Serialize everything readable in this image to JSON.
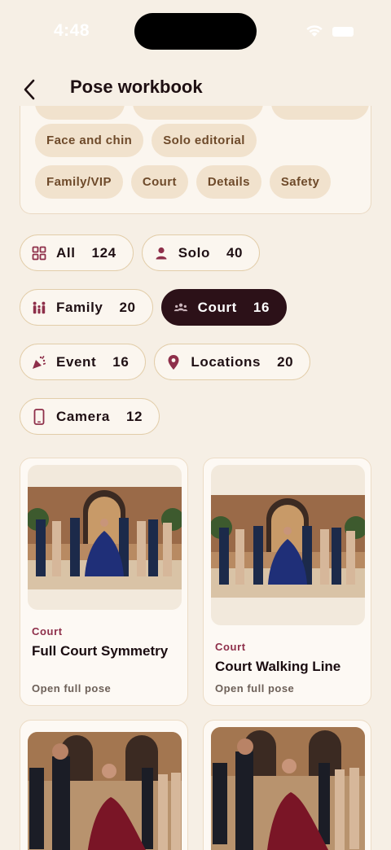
{
  "status": {
    "time": "4:48"
  },
  "header": {
    "title": "Pose workbook",
    "back_icon": "chevron-left-icon"
  },
  "tips": {
    "row1": [
      "Face and chin",
      "Solo editorial"
    ],
    "row2": [
      "Family/VIP",
      "Court",
      "Details",
      "Safety"
    ]
  },
  "filters": [
    {
      "label": "All",
      "count": "124",
      "icon": "grid-icon",
      "active": false
    },
    {
      "label": "Solo",
      "count": "40",
      "icon": "person-icon",
      "active": false
    },
    {
      "label": "Family",
      "count": "20",
      "icon": "family-icon",
      "active": false
    },
    {
      "label": "Court",
      "count": "16",
      "icon": "group-icon",
      "active": true
    },
    {
      "label": "Event",
      "count": "16",
      "icon": "party-popper-icon",
      "active": false
    },
    {
      "label": "Locations",
      "count": "20",
      "icon": "location-pin-icon",
      "active": false
    },
    {
      "label": "Camera",
      "count": "12",
      "icon": "phone-icon",
      "active": false
    }
  ],
  "cards": [
    {
      "category": "Court",
      "title": "Full Court Symmetry",
      "action": "Open full pose"
    },
    {
      "category": "Court",
      "title": "Court Walking Line",
      "action": "Open full pose"
    },
    {
      "category": "",
      "title": "",
      "action": ""
    },
    {
      "category": "",
      "title": "",
      "action": ""
    }
  ],
  "colors": {
    "background": "#f6efe5",
    "accent": "#8e2f4a",
    "active_pill": "#2c1118",
    "chip": "#f1e2cd"
  }
}
